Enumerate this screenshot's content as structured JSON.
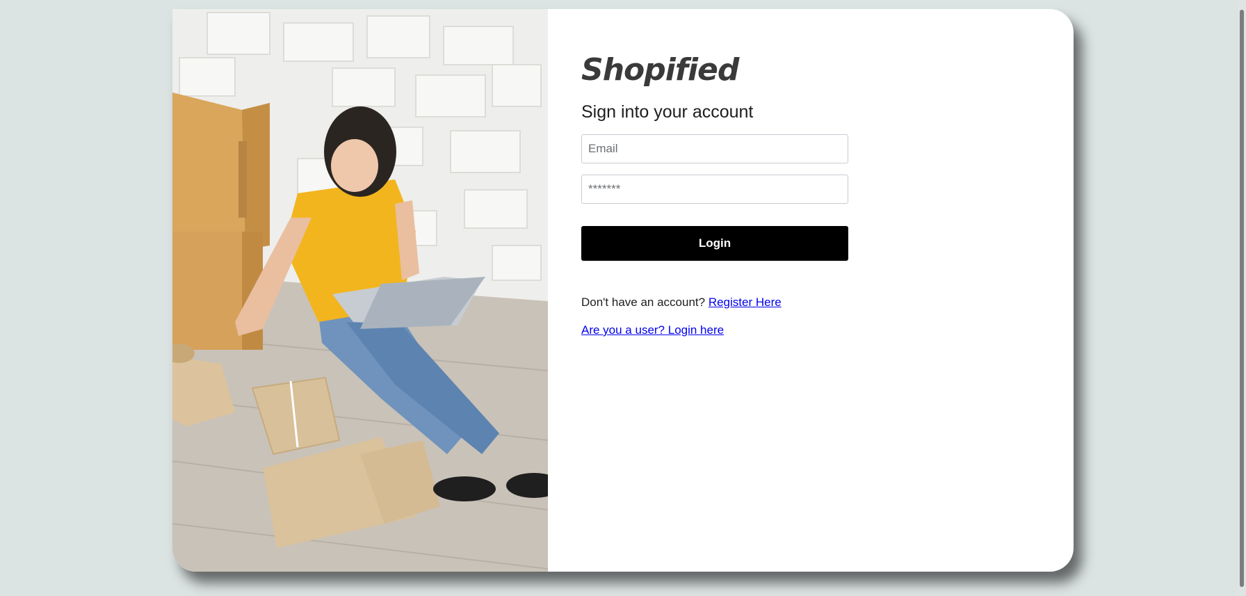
{
  "brand": {
    "name": "Shopified"
  },
  "form": {
    "heading": "Sign into your account",
    "email_placeholder": "Email",
    "password_placeholder": "*******",
    "login_label": "Login"
  },
  "links": {
    "register_prompt": "Don't have an account?",
    "register_label": "Register Here",
    "user_login_label": "Are you a user? Login here"
  },
  "colors": {
    "background": "#dbe3e3",
    "card": "#ffffff",
    "button": "#000000",
    "link": "#0000ee"
  }
}
